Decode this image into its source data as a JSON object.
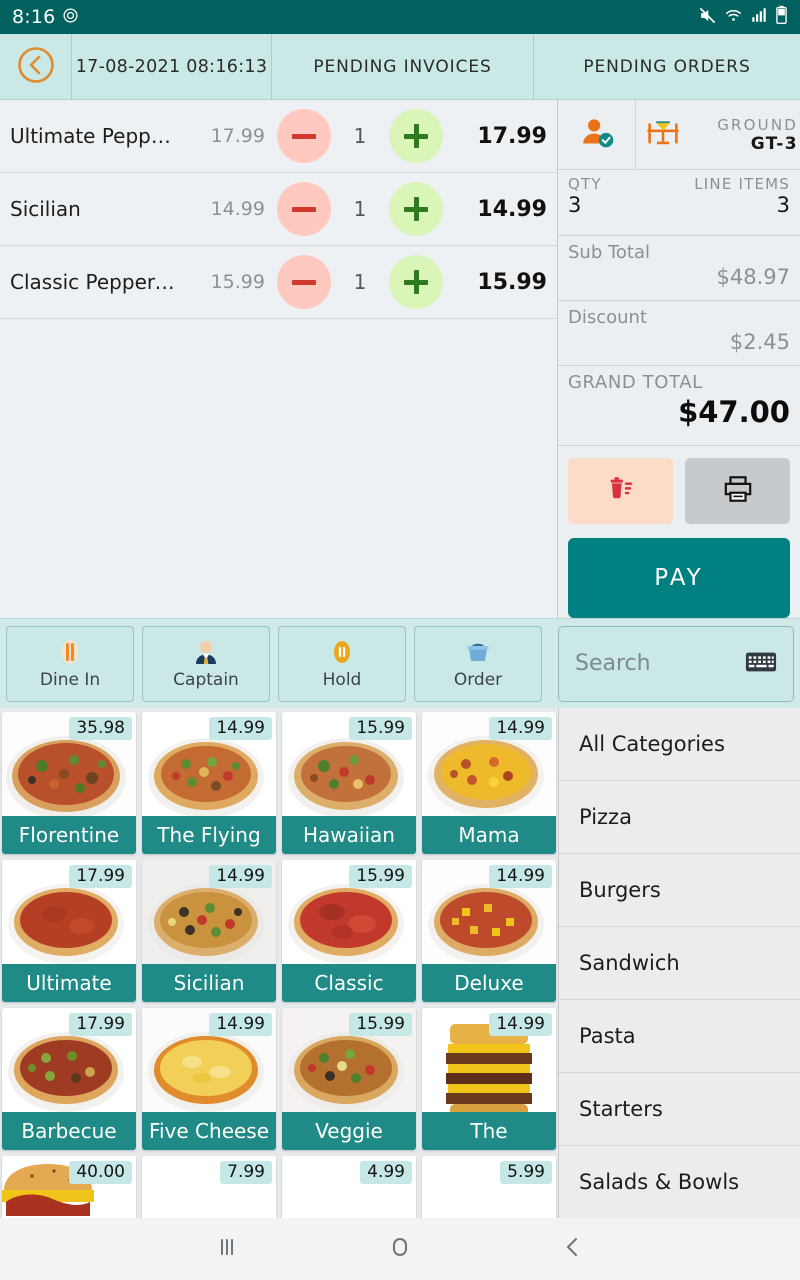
{
  "status_bar": {
    "time": "8:16",
    "icons": [
      "alarm-icon",
      "mute-icon",
      "wifi-icon",
      "signal-icon",
      "battery-icon"
    ],
    "background": "#00615e"
  },
  "top_bar": {
    "back_icon": "back-circle-icon",
    "datetime": "17-08-2021 08:16:13",
    "pending_invoices_label": "PENDING INVOICES",
    "pending_orders_label": "PENDING ORDERS",
    "background": "#c9e8e6"
  },
  "cart": {
    "items": [
      {
        "name": "Ultimate Pepper…",
        "unit_price": "17.99",
        "qty": "1",
        "line_total": "17.99"
      },
      {
        "name": "Sicilian",
        "unit_price": "14.99",
        "qty": "1",
        "line_total": "14.99"
      },
      {
        "name": "Classic Pepperoni",
        "unit_price": "15.99",
        "qty": "1",
        "line_total": "15.99"
      }
    ],
    "decrement_icon": "minus-icon",
    "increment_icon": "plus-icon"
  },
  "order_summary": {
    "customer_icon": "customer-verified-icon",
    "table_icon": "dining-table-icon",
    "zone": "GROUND",
    "table_code": "GT-3",
    "qty_label": "QTY",
    "qty_value": "3",
    "line_items_label": "LINE ITEMS",
    "line_items_value": "3",
    "sub_total_label": "Sub Total",
    "sub_total_value": "$48.97",
    "discount_label": "Discount",
    "discount_value": "$2.45",
    "grand_total_label": "GRAND TOTAL",
    "grand_total_value": "$47.00",
    "delete_icon": "trash-icon",
    "print_icon": "printer-icon",
    "pay_label": "PAY",
    "pay_color": "#008080"
  },
  "toolbar": {
    "buttons": [
      {
        "label": "Dine In",
        "icon": "cutlery-icon"
      },
      {
        "label": "Captain",
        "icon": "waiter-icon"
      },
      {
        "label": "Hold",
        "icon": "pause-icon"
      },
      {
        "label": "Order",
        "icon": "takeaway-icon"
      }
    ],
    "search_placeholder": "Search",
    "keyboard_icon": "keyboard-icon"
  },
  "products": [
    {
      "name": "Florentine",
      "price": "35.98",
      "img": "pizza-veggie-dark"
    },
    {
      "name": "The Flying",
      "price": "14.99",
      "img": "pizza-supreme"
    },
    {
      "name": "Hawaiian",
      "price": "15.99",
      "img": "pizza-hawaiian"
    },
    {
      "name": "Mama",
      "price": "14.99",
      "img": "pizza-cheese-yellow"
    },
    {
      "name": "Ultimate",
      "price": "17.99",
      "img": "pizza-pepperoni-red"
    },
    {
      "name": "Sicilian",
      "price": "14.99",
      "img": "pizza-sicilian"
    },
    {
      "name": "Classic",
      "price": "15.99",
      "img": "pizza-classic-red"
    },
    {
      "name": "Deluxe",
      "price": "14.99",
      "img": "pizza-deluxe-yellow"
    },
    {
      "name": "Barbecue",
      "price": "17.99",
      "img": "pizza-barbecue"
    },
    {
      "name": "Five Cheese",
      "price": "14.99",
      "img": "pizza-five-cheese"
    },
    {
      "name": "Veggie",
      "price": "15.99",
      "img": "pizza-veggie"
    },
    {
      "name": "The",
      "price": "14.99",
      "img": "burger-stack"
    }
  ],
  "products_partial": [
    {
      "name": "",
      "price": "40.00",
      "img": "burger-bun"
    },
    {
      "name": "",
      "price": "7.99",
      "img": "blank"
    },
    {
      "name": "",
      "price": "4.99",
      "img": "blank"
    },
    {
      "name": "",
      "price": "5.99",
      "img": "blank"
    }
  ],
  "categories": [
    {
      "label": "All Categories"
    },
    {
      "label": "Pizza"
    },
    {
      "label": "Burgers"
    },
    {
      "label": "Sandwich"
    },
    {
      "label": "Pasta"
    },
    {
      "label": "Starters"
    },
    {
      "label": "Salads & Bowls"
    }
  ],
  "nav_bar": {
    "recents_icon": "recents-icon",
    "home_icon": "home-icon",
    "back_icon": "back-icon"
  }
}
